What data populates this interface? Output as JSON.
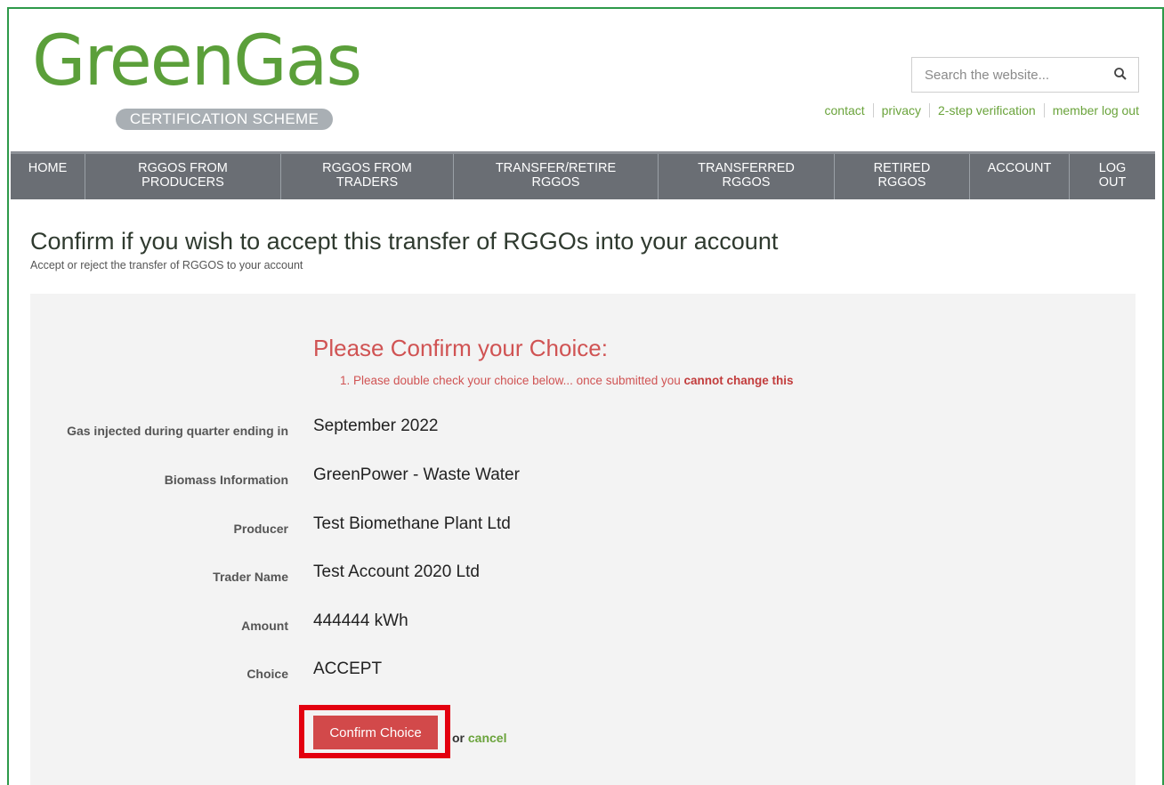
{
  "logo": {
    "word": "GreenGas",
    "subtitle": "CERTIFICATION SCHEME"
  },
  "search": {
    "placeholder": "Search the website..."
  },
  "toplinks": [
    "contact",
    "privacy",
    "2-step verification",
    "member log out"
  ],
  "nav": [
    "HOME",
    "RGGOS FROM PRODUCERS",
    "RGGOS FROM TRADERS",
    "TRANSFER/RETIRE RGGOS",
    "TRANSFERRED RGGOS",
    "RETIRED RGGOS",
    "ACCOUNT",
    "LOG OUT"
  ],
  "page": {
    "title": "Confirm if you wish to accept this transfer of RGGOs into your account",
    "subtitle": "Accept or reject the transfer of RGGOS to your account"
  },
  "confirm": {
    "heading": "Please Confirm your Choice:",
    "note_prefix": "1. Please double check your choice below... once submitted you ",
    "note_bold": "cannot change this"
  },
  "fields": [
    {
      "label": "Gas injected during quarter ending in",
      "value": "September 2022"
    },
    {
      "label": "Biomass Information",
      "value": "GreenPower - Waste Water"
    },
    {
      "label": "Producer",
      "value": "Test Biomethane Plant Ltd"
    },
    {
      "label": "Trader Name",
      "value": "Test Account 2020 Ltd"
    },
    {
      "label": "Amount",
      "value": "444444 kWh"
    },
    {
      "label": "Choice",
      "value": "ACCEPT"
    }
  ],
  "actions": {
    "confirm_label": "Confirm Choice",
    "or_text": "or",
    "cancel_label": "cancel"
  },
  "colors": {
    "brand_green": "#5b9f3a",
    "link_green": "#6aa33b",
    "nav_bg": "#6a6e74",
    "alert_red": "#d05353",
    "button_red": "#d2494a",
    "highlight_red": "#e3000f"
  }
}
